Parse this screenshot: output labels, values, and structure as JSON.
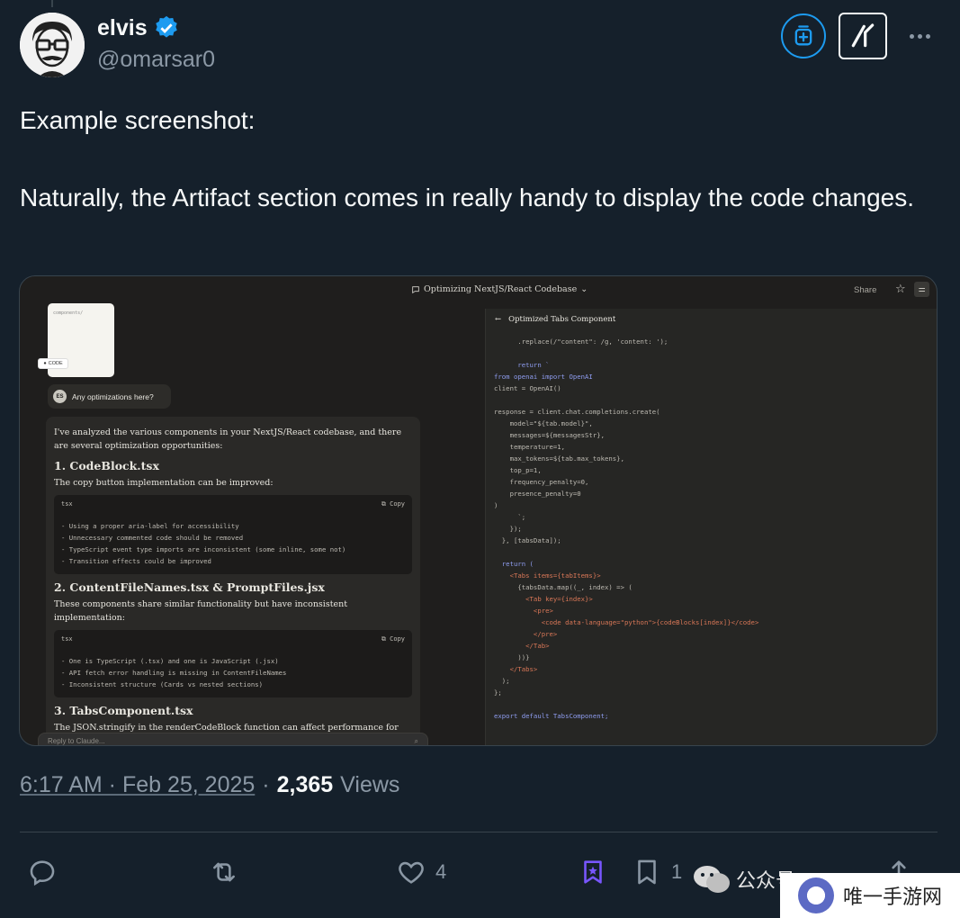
{
  "author": {
    "name": "elvis",
    "handle": "@omarsar0"
  },
  "tweet": {
    "line1": "Example screenshot:",
    "line2": "Naturally, the Artifact section comes in really handy to display the code changes."
  },
  "screenshot": {
    "title": "Optimizing NextJS/React Codebase",
    "share": "Share",
    "file_name": "components/",
    "code_badge": "CODE",
    "user_initials": "ES",
    "user_message": "Any optimizations here?",
    "reply": {
      "intro": "I've analyzed the various components in your NextJS/React codebase, and there are several optimization opportunities:",
      "sections": [
        {
          "heading": "1. CodeBlock.tsx",
          "desc": "The copy button implementation can be improved:",
          "lang": "tsx",
          "copy": "Copy",
          "items": [
            "- Using a proper aria-label for accessibility",
            "- Unnecessary commented code should be removed",
            "- TypeScript event type imports are inconsistent (some inline, some not)",
            "- Transition effects could be improved"
          ]
        },
        {
          "heading": "2. ContentFileNames.tsx & PromptFiles.jsx",
          "desc": "These components share similar functionality but have inconsistent implementation:",
          "lang": "tsx",
          "copy": "Copy",
          "items": [
            "- One is TypeScript (.tsx) and one is JavaScript (.jsx)",
            "- API fetch error handling is missing in ContentFileNames",
            "- Inconsistent structure (Cards vs nested sections)"
          ]
        },
        {
          "heading": "3. TabsComponent.tsx",
          "desc": "The JSON.stringify in the renderCodeBlock function can affect performance for large"
        }
      ],
      "input_placeholder": "Reply to Claude..."
    },
    "artifact": {
      "title": "Optimized Tabs Component",
      "code": [
        "      .replace(/\"content\": /g, 'content: ');",
        "",
        "      return `",
        "from openai import OpenAI",
        "client = OpenAI()",
        "",
        "response = client.chat.completions.create(",
        "    model=\"${tab.model}\",",
        "    messages=${messagesStr},",
        "    temperature=1,",
        "    max_tokens=${tab.max_tokens},",
        "    top_p=1,",
        "    frequency_penalty=0,",
        "    presence_penalty=0",
        ")",
        "      `;",
        "    });",
        "  }, [tabsData]);",
        "",
        "  return (",
        "    <Tabs items={tabItems}>",
        "      {tabsData.map((_, index) => (",
        "        <Tab key={index}>",
        "          <pre>",
        "            <code data-language=\"python\">{codeBlocks[index]}</code>",
        "          </pre>",
        "        </Tab>",
        "      ))}",
        "    </Tabs>",
        "  );",
        "};",
        "",
        "export default TabsComponent;"
      ]
    }
  },
  "meta": {
    "timestamp": "6:17 AM · Feb 25, 2025",
    "separator": "·",
    "views_count": "2,365",
    "views_label": "Views"
  },
  "actions": {
    "likes": "4",
    "bookmarks": "1"
  },
  "watermark": {
    "overlay_text": "公众号",
    "site": "唯一手游网"
  },
  "colors": {
    "background": "#15202b",
    "accent": "#1d9bf0",
    "secondary_text": "#8b98a5",
    "grok_purple": "#7856ff"
  }
}
